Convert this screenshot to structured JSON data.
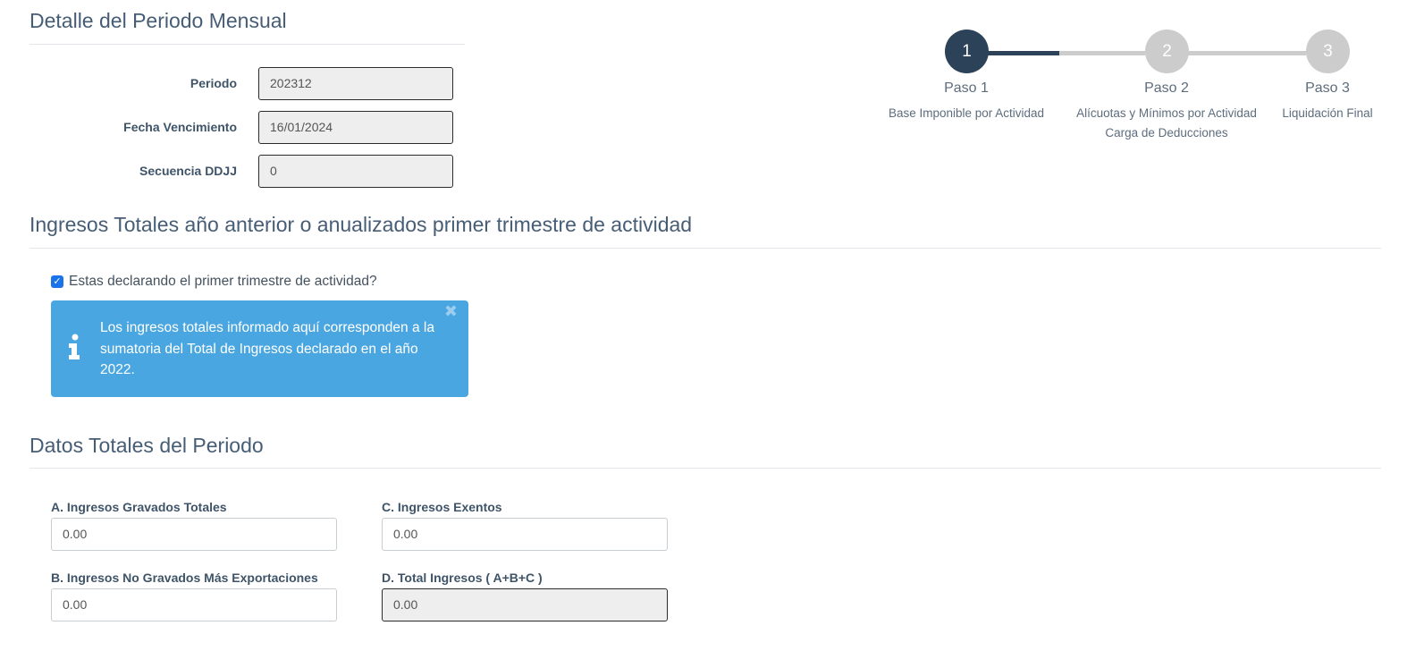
{
  "periodo_section": {
    "title": "Detalle del Periodo Mensual",
    "fields": [
      {
        "label": "Periodo",
        "value": "202312"
      },
      {
        "label": "Fecha Vencimiento",
        "value": "16/01/2024"
      },
      {
        "label": "Secuencia DDJJ",
        "value": "0"
      }
    ]
  },
  "stepper": {
    "active_color": "#2c4258",
    "inactive_color": "#cccccc",
    "steps": [
      {
        "number": "1",
        "title": "Paso 1",
        "desc": "Base Imponible por Actividad",
        "desc2": ""
      },
      {
        "number": "2",
        "title": "Paso 2",
        "desc": "Alícuotas y Mínimos por Actividad",
        "desc2": "Carga de Deducciones"
      },
      {
        "number": "3",
        "title": "Paso 3",
        "desc": "Liquidación Final",
        "desc2": ""
      }
    ]
  },
  "ingresos_section": {
    "title": "Ingresos Totales año anterior o anualizados primer trimestre de actividad",
    "checkbox_label": "Estas declarando el primer trimestre de actividad?",
    "checkbox_checked": true,
    "alert_text": "Los ingresos totales informado aquí corresponden a la sumatoria del Total de Ingresos declarado en el año 2022.",
    "alert_color": "#4aa6e0",
    "alert_icon": "info-icon",
    "close_glyph": "✖"
  },
  "totales_section": {
    "title": "Datos Totales del Periodo",
    "fields": {
      "a": {
        "label": "A. Ingresos Gravados Totales",
        "value": "0.00"
      },
      "b": {
        "label": "B. Ingresos No Gravados Más Exportaciones",
        "value": "0.00"
      },
      "c": {
        "label": "C. Ingresos Exentos",
        "value": "0.00"
      },
      "d": {
        "label": "D. Total Ingresos ( A+B+C )",
        "value": "0.00"
      }
    }
  }
}
